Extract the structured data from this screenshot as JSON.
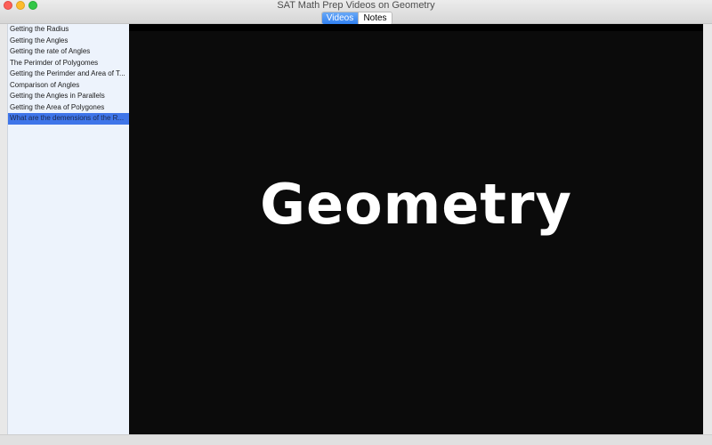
{
  "window": {
    "title": "SAT Math Prep Videos on Geometry"
  },
  "tabs": [
    {
      "label": "Videos",
      "active": true
    },
    {
      "label": "Notes",
      "active": false
    }
  ],
  "sidebar": {
    "items": [
      {
        "label": "Getting the Radius"
      },
      {
        "label": "Getting the Angles"
      },
      {
        "label": "Getting the rate of Angles"
      },
      {
        "label": "The Perimder of Polygomes"
      },
      {
        "label": "Getting the Perimder and Area of T..."
      },
      {
        "label": "Comparison of Angles"
      },
      {
        "label": "Getting the Angles in Parallels"
      },
      {
        "label": "Getting the Area of Polygones"
      },
      {
        "label": "What are the demensions of the R...",
        "selected": true
      }
    ]
  },
  "video": {
    "title_text": "Geometry"
  },
  "colors": {
    "accent": "#3f75e9",
    "sidebar_bg": "#edf3fc",
    "video_bg": "#0b0b0b",
    "traffic_close": "#fc5f57",
    "traffic_minimize": "#fdbc2e",
    "traffic_zoom": "#33c748"
  }
}
